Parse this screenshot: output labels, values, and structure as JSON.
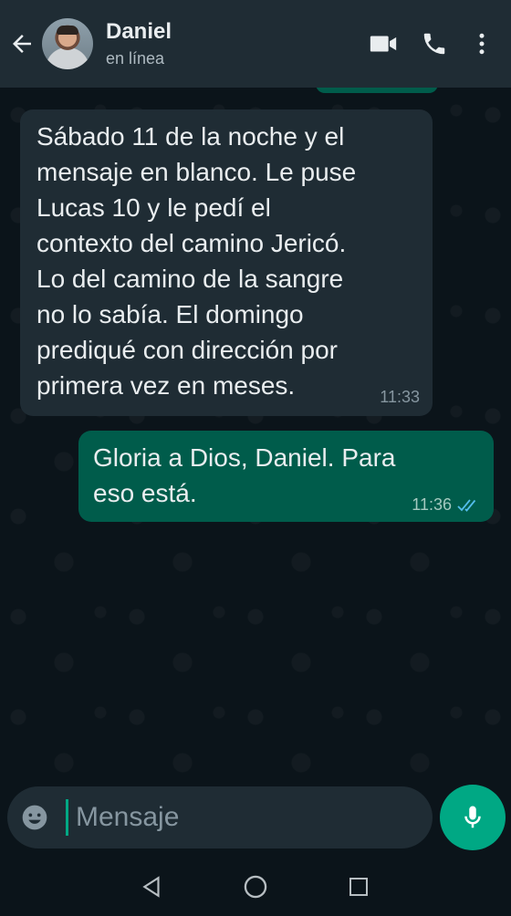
{
  "contact": {
    "name": "Daniel",
    "status": "en línea"
  },
  "header": {
    "back_icon": "arrow-left-icon",
    "video_icon": "video-call-icon",
    "call_icon": "phone-icon",
    "menu_icon": "more-vert-icon"
  },
  "messages": [
    {
      "direction": "incoming",
      "text": "Sábado 11 de la noche y el\nmensaje en blanco. Le puse\nLucas 10 y le pedí el\ncontexto del camino Jericó.\nLo del camino de la sangre\nno lo sabía. El domingo\nprediqué con dirección por\nprimera vez en meses.",
      "time": "11:33"
    },
    {
      "direction": "outgoing",
      "text": "Gloria a Dios, Daniel. Para\neso está.",
      "time": "11:36",
      "status": "read"
    }
  ],
  "composer": {
    "placeholder": "Mensaje",
    "emoji_icon": "emoji-icon",
    "mic_icon": "mic-icon"
  },
  "navbar": {
    "back": "nav-back-icon",
    "home": "nav-home-icon",
    "recents": "nav-recents-icon"
  },
  "colors": {
    "header_bg": "#1f2c34",
    "chat_bg": "#0b141a",
    "incoming_bubble": "#1f2c34",
    "outgoing_bubble": "#005c4b",
    "accent": "#00a884",
    "read_ticks": "#53bdeb"
  }
}
